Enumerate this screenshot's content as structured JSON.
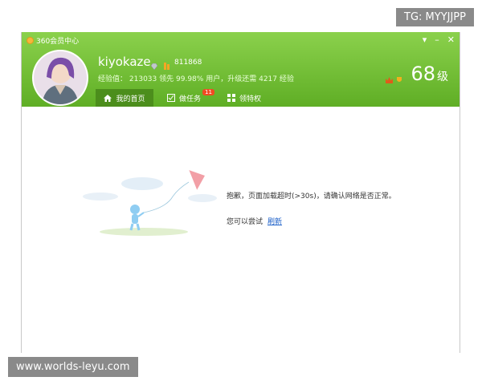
{
  "window": {
    "title": "360会员中心",
    "controls": {
      "menu": "▾",
      "minimize": "–",
      "close": "✕"
    }
  },
  "profile": {
    "username": "kiyokaze",
    "coins": "811868",
    "stats": {
      "exp_label": "经验值：",
      "exp_value": "213033",
      "lead_label": "领先",
      "lead_value": "99.98%",
      "users_label": "用户，升级还需",
      "needed_value": "4217",
      "needed_unit": "经验"
    },
    "level": {
      "number": "68",
      "unit": "级"
    },
    "icons": [
      "vip-diamond-icon",
      "coin-stack-icon",
      "crown-icon",
      "medal-icon"
    ]
  },
  "tabs": [
    {
      "label": "我的首页",
      "icon": "home-icon",
      "active": true
    },
    {
      "label": "做任务",
      "icon": "task-icon",
      "badge": "11"
    },
    {
      "label": "领特权",
      "icon": "privilege-icon"
    }
  ],
  "error": {
    "message": "抱歉，页面加载超时(>30s)，请确认网络是否正常。",
    "retry_text": "您可以尝试",
    "refresh_label": "刷新"
  },
  "watermarks": {
    "top_right": "TG: MYYJJPP",
    "bottom_left": "www.worlds-leyu.com"
  },
  "colors": {
    "header_green": "#6cbf2e",
    "tab_active": "#4c8e1c",
    "badge": "#f04a22",
    "link": "#1a5ec8"
  }
}
